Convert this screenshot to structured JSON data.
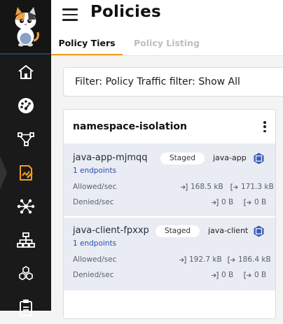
{
  "app": {
    "logo_alt": "cat mascot logo"
  },
  "topbar": {
    "title": "Policies",
    "menu_icon": "hamburger-icon"
  },
  "tabs": [
    {
      "label": "Policy Tiers",
      "active": true
    },
    {
      "label": "Policy Listing",
      "active": false
    }
  ],
  "filter": {
    "text": "Filter: Policy Traffic filter: Show All"
  },
  "sidebar": {
    "items": [
      {
        "name": "dashboard",
        "icon": "home-icon",
        "active": false
      },
      {
        "name": "service-graph",
        "icon": "gauge-icon",
        "active": false
      },
      {
        "name": "flow",
        "icon": "flow-icon",
        "active": false
      },
      {
        "name": "policies",
        "icon": "policy-icon",
        "active": true
      },
      {
        "name": "network",
        "icon": "network-icon",
        "active": false
      },
      {
        "name": "hierarchy",
        "icon": "hierarchy-icon",
        "active": false
      },
      {
        "name": "cluster",
        "icon": "cluster-icon",
        "active": false
      },
      {
        "name": "clipboard",
        "icon": "clipboard-icon",
        "active": false
      }
    ]
  },
  "colors": {
    "accent": "#f39c1f",
    "sidebar_bg": "#1a1a1a",
    "policy_bg": "#e9ecf2",
    "link": "#2b4fb0"
  },
  "tier": {
    "title": "namespace-isolation",
    "menu_icon": "kebab-menu-icon",
    "policies": [
      {
        "name": "java-app-mjmqq",
        "status": "Staged",
        "namespace": "java-app",
        "endpoints": "1 endpoints",
        "allowed_label": "Allowed/sec",
        "allowed_in": "168.5 kB",
        "allowed_out": "171.3 kB",
        "denied_label": "Denied/sec",
        "denied_in": "0 B",
        "denied_out": "0 B"
      },
      {
        "name": "java-client-fpxxp",
        "status": "Staged",
        "namespace": "java-client",
        "endpoints": "1 endpoints",
        "allowed_label": "Allowed/sec",
        "allowed_in": "192.7 kB",
        "allowed_out": "186.4 kB",
        "denied_label": "Denied/sec",
        "denied_in": "0 B",
        "denied_out": "0 B"
      }
    ]
  }
}
